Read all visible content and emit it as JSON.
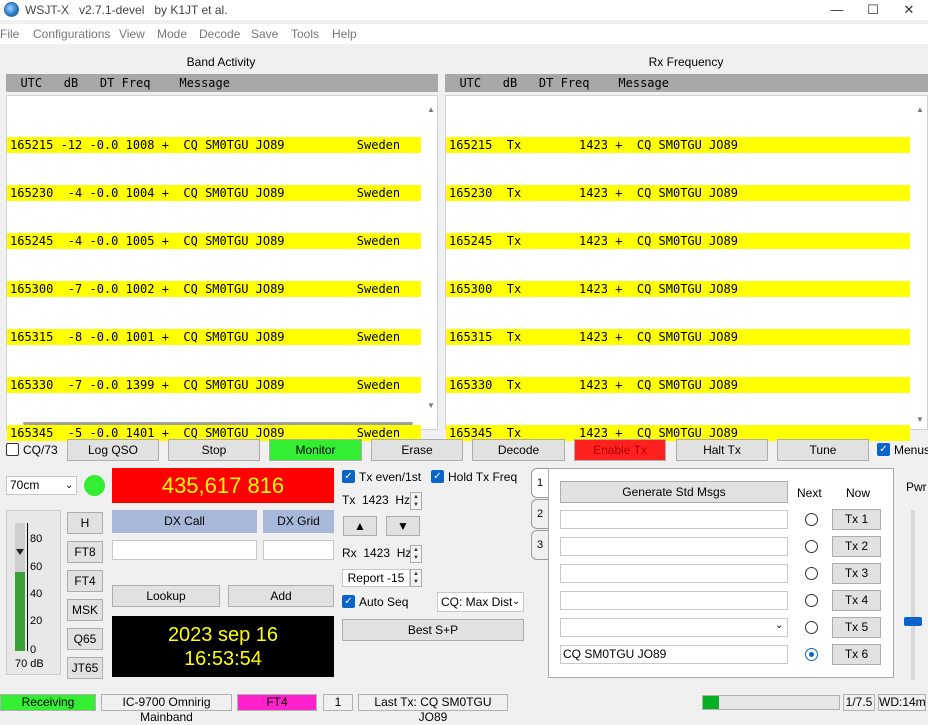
{
  "window": {
    "title": "WSJT-X   v2.7.1-devel   by K1JT et al.",
    "min": "—",
    "max": "☐",
    "close": "✕"
  },
  "menu": [
    "File",
    "Configurations",
    "View",
    "Mode",
    "Decode",
    "Save",
    "Tools",
    "Help"
  ],
  "band_activity": {
    "title": "Band Activity",
    "header": "  UTC   dB   DT Freq    Message",
    "rows": [
      "165215 -12 -0.0 1008 +  CQ SM0TGU JO89          Sweden",
      "165230  -4 -0.0 1004 +  CQ SM0TGU JO89          Sweden",
      "165245  -4 -0.0 1005 +  CQ SM0TGU JO89          Sweden",
      "165300  -7 -0.0 1002 +  CQ SM0TGU JO89          Sweden",
      "165315  -8 -0.0 1001 +  CQ SM0TGU JO89          Sweden",
      "165330  -7 -0.0 1399 +  CQ SM0TGU JO89          Sweden",
      "165345  -5 -0.0 1401 +  CQ SM0TGU JO89          Sweden"
    ]
  },
  "rx_frequency": {
    "title": "Rx Frequency",
    "header": "  UTC   dB   DT Freq    Message",
    "rows": [
      "165215  Tx        1423 +  CQ SM0TGU JO89",
      "165230  Tx        1423 +  CQ SM0TGU JO89",
      "165245  Tx        1423 +  CQ SM0TGU JO89",
      "165300  Tx        1423 +  CQ SM0TGU JO89",
      "165315  Tx        1423 +  CQ SM0TGU JO89",
      "165330  Tx        1423 +  CQ SM0TGU JO89",
      "165345  Tx        1423 +  CQ SM0TGU JO89"
    ]
  },
  "controls": {
    "cq73": "CQ/73",
    "log_qso": "Log QSO",
    "stop": "Stop",
    "monitor": "Monitor",
    "erase": "Erase",
    "decode": "Decode",
    "enable_tx": "Enable Tx",
    "halt_tx": "Halt Tx",
    "tune": "Tune",
    "menus": "Menus"
  },
  "colors": {
    "monitor": "#33ee33",
    "enable_tx": "#ff2020",
    "freq_bg": "#ff0000",
    "freq_fg": "#ffff00",
    "clock_bg": "#000000",
    "clock_fg": "#ffff00",
    "dx_label": "#a8b8d8",
    "receiving": "#33ee33",
    "mode_badge": "#ff22cc",
    "decode_row": "#ffff00"
  },
  "band": "70cm",
  "frequency": "435,617 816",
  "mode_buttons": [
    "H",
    "FT8",
    "FT4",
    "MSK",
    "Q65",
    "JT65"
  ],
  "meter": {
    "ticks": [
      "80",
      "60",
      "40",
      "20",
      "0"
    ],
    "label": "70 dB",
    "level": 0.62
  },
  "dx": {
    "call_label": "DX Call",
    "grid_label": "DX Grid",
    "call_value": "",
    "grid_value": "",
    "lookup": "Lookup",
    "add": "Add"
  },
  "clock": {
    "date": "2023 sep 16",
    "time": "16:53:54"
  },
  "tx": {
    "tx_even": "Tx even/1st",
    "hold_tx_freq": "Hold Tx Freq",
    "tx_freq": "Tx  1423  Hz",
    "rx_freq": "Rx  1423  Hz",
    "report": "Report -15",
    "auto_seq": "Auto Seq",
    "cq_mode": "CQ: Max Dist",
    "best_sp": "Best S+P",
    "up": "▲",
    "down": "▼"
  },
  "tabs": [
    "1",
    "2",
    "3"
  ],
  "messages": {
    "generate": "Generate Std Msgs",
    "next": "Next",
    "now": "Now",
    "items": [
      {
        "text": "",
        "btn": "Tx 1"
      },
      {
        "text": "",
        "btn": "Tx 2"
      },
      {
        "text": "",
        "btn": "Tx 3"
      },
      {
        "text": "",
        "btn": "Tx 4"
      },
      {
        "text": "",
        "btn": "Tx 5"
      },
      {
        "text": "CQ SM0TGU JO89",
        "btn": "Tx 6"
      }
    ]
  },
  "pwr": "Pwr",
  "status": {
    "receiving": "Receiving",
    "rig": "IC-9700 Omnirig Mainband",
    "mode": "FT4",
    "count": "1",
    "last_tx": "Last Tx: CQ SM0TGU JO89",
    "progress": 0.12,
    "period": "1/7.5",
    "wd": "WD:14m"
  }
}
